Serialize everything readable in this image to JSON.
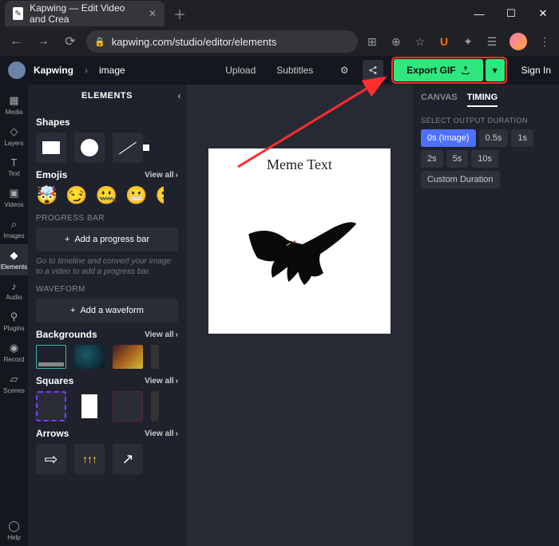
{
  "browser": {
    "tab_title": "Kapwing — Edit Video and Crea",
    "url": "kapwing.com/studio/editor/elements"
  },
  "header": {
    "brand": "Kapwing",
    "crumb": "image",
    "upload": "Upload",
    "subtitles": "Subtitles",
    "export_label": "Export GIF",
    "signin": "Sign In"
  },
  "rail": {
    "items": [
      "Media",
      "Layers",
      "Text",
      "Videos",
      "Images",
      "Elements",
      "Audio",
      "Plugins",
      "Record",
      "Scenes"
    ],
    "help": "Help"
  },
  "panel": {
    "title": "ELEMENTS",
    "shapes": "Shapes",
    "emojis": "Emojis",
    "viewall": "View all",
    "progress_hdr": "PROGRESS BAR",
    "add_progress": "Add a progress bar",
    "progress_hint": "Go to timeline and convert your image to a video to add a progress bar.",
    "waveform_hdr": "WAVEFORM",
    "add_waveform": "Add a waveform",
    "backgrounds": "Backgrounds",
    "squares": "Squares",
    "arrows": "Arrows"
  },
  "canvas": {
    "meme_text": "Meme Text"
  },
  "right": {
    "tab_canvas": "CANVAS",
    "tab_timing": "TIMING",
    "duration_hdr": "SELECT OUTPUT DURATION",
    "durations": [
      "0s (Image)",
      "0.5s",
      "1s",
      "2s",
      "5s",
      "10s",
      "Custom Duration"
    ]
  }
}
